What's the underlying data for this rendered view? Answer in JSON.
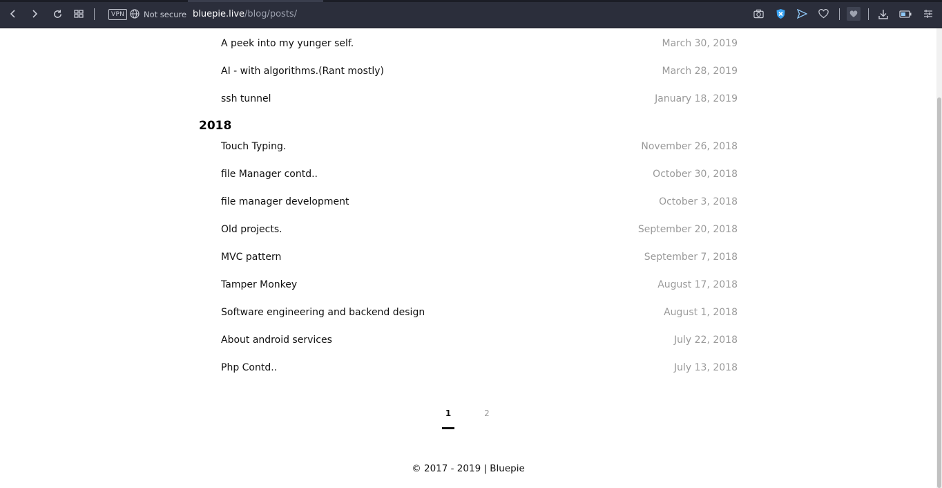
{
  "browser": {
    "vpn_label": "VPN",
    "security_label": "Not secure",
    "url_host": "bluepie.live",
    "url_path": "/blog/posts/"
  },
  "posts_2019_tail": [
    {
      "title": "A peek into my yunger self.",
      "date": "March 30, 2019"
    },
    {
      "title": "AI - with algorithms.(Rant mostly)",
      "date": "March 28, 2019"
    },
    {
      "title": "ssh tunnel",
      "date": "January 18, 2019"
    }
  ],
  "year_2018": {
    "heading": "2018",
    "posts": [
      {
        "title": "Touch Typing.",
        "date": "November 26, 2018"
      },
      {
        "title": "file Manager contd..",
        "date": "October 30, 2018"
      },
      {
        "title": "file manager development",
        "date": "October 3, 2018"
      },
      {
        "title": "Old projects.",
        "date": "September 20, 2018"
      },
      {
        "title": "MVC pattern",
        "date": "September 7, 2018"
      },
      {
        "title": "Tamper Monkey",
        "date": "August 17, 2018"
      },
      {
        "title": "Software engineering and backend design",
        "date": "August 1, 2018"
      },
      {
        "title": "About android services",
        "date": "July 22, 2018"
      },
      {
        "title": "Php Contd..",
        "date": "July 13, 2018"
      }
    ]
  },
  "pagination": {
    "pages": [
      "1",
      "2"
    ],
    "current": "1"
  },
  "footer": {
    "text": "© 2017 - 2019 | Bluepie"
  },
  "icons": {
    "toolbar": [
      "back-icon",
      "forward-icon",
      "reload-icon",
      "tabs-grid-icon",
      "globe-icon",
      "camera-icon",
      "shield-icon",
      "send-icon",
      "heart-icon",
      "wallet-icon",
      "download-icon",
      "battery-icon",
      "menu-icon"
    ]
  },
  "colors": {
    "toolbar_bg": "#2b2e3b",
    "shield_blue": "#3aa3f2",
    "date_grey": "#9a9a9a"
  }
}
